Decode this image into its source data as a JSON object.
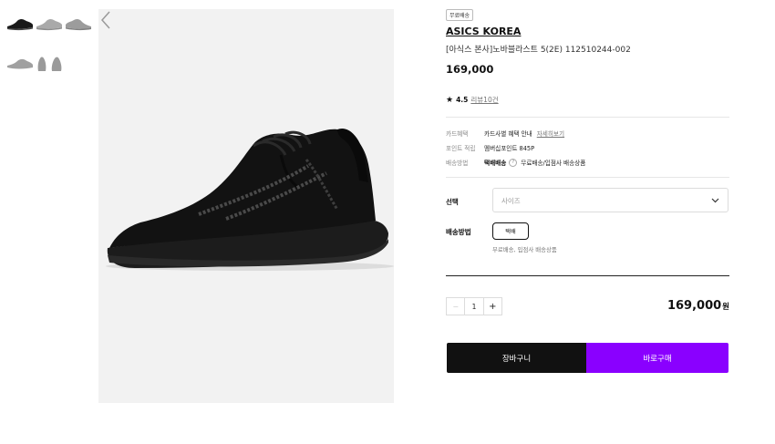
{
  "gallery": {
    "thumbnails": [
      {
        "name": "black side view",
        "color": "#1a1a1a"
      },
      {
        "name": "grey side view",
        "color": "#a9a9a9"
      },
      {
        "name": "grey side view alt",
        "color": "#9c9c9c"
      },
      {
        "name": "grey lateral view",
        "color": "#a0a0a0"
      },
      {
        "name": "grey heel view",
        "color": "#9a9a9a"
      },
      {
        "name": "grey front view",
        "color": "#9a9a9a"
      }
    ],
    "background_color": "#f2f2f2"
  },
  "product": {
    "badge": "무료배송",
    "brand": "ASICS KOREA",
    "name": "[아식스 본사]노바블라스트 5(2E) 112510244-002",
    "price": "169,000",
    "rating": {
      "star": "★",
      "score": "4.5",
      "reviews": "리뷰10건"
    }
  },
  "info": {
    "card": {
      "label": "카드혜택",
      "value": "카드사별 혜택 안내",
      "link": "자세히보기"
    },
    "points": {
      "label": "포인트 적립",
      "value": "멤버십포인트 845P"
    },
    "shipping": {
      "label": "배송방법",
      "value_bold": "택배배송",
      "help": "?",
      "value": "무료배송/입점사 배송상품"
    }
  },
  "options": {
    "select_label": "선택",
    "select_placeholder": "사이즈",
    "shipping_label": "배송방법",
    "shipping_option": "택배",
    "shipping_note": "무료배송, 입점사 배송상품"
  },
  "purchase": {
    "qty_minus": "−",
    "qty_value": "1",
    "qty_plus": "+",
    "total_price": "169,000",
    "total_unit": "원",
    "cart_label": "장바구니",
    "buy_label": "바로구매"
  },
  "colors": {
    "buy_button": "#8a00ff",
    "cart_button": "#111111"
  }
}
